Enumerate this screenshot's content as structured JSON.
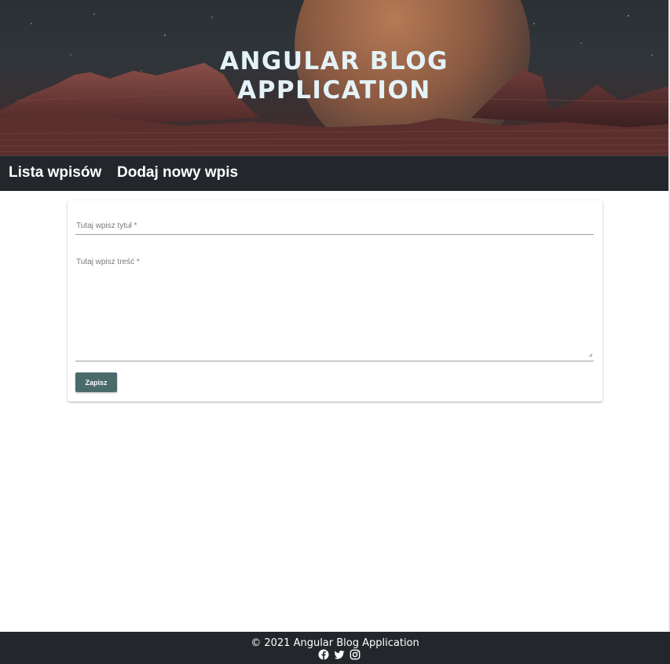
{
  "header": {
    "title_line1": "ANGULAR BLOG",
    "title_line2": "APPLICATION"
  },
  "nav": {
    "items": [
      {
        "label": "Lista wpisów"
      },
      {
        "label": "Dodaj nowy wpis"
      }
    ]
  },
  "form": {
    "title_placeholder": "Tutaj wpisz tytuł *",
    "title_value": "",
    "content_placeholder": "Tutaj wpisz treść *",
    "content_value": "",
    "submit_label": "Zapisz"
  },
  "footer": {
    "copyright": "© 2021 Angular Blog Application",
    "social_icons": [
      "facebook-icon",
      "twitter-icon",
      "instagram-icon"
    ]
  },
  "colors": {
    "nav_bg": "#23272b",
    "button_bg": "#4a6a6c",
    "title_color": "#e4f3f8"
  }
}
